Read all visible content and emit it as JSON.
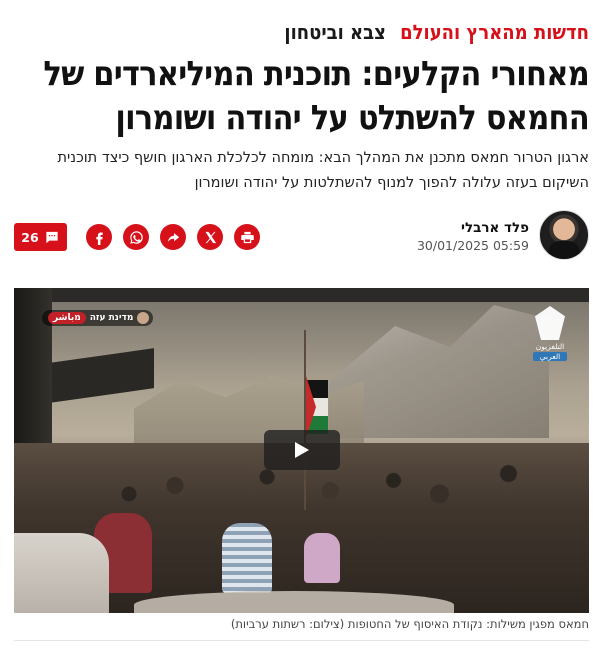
{
  "breadcrumb": {
    "section": "חדשות מהארץ והעולם",
    "subsection": "צבא וביטחון"
  },
  "article": {
    "headline": "מאחורי הקלעים: תוכנית המיליארדים של החמאס להשתלט על יהודה ושומרון",
    "subheadline": "ארגון הטרור חמאס מתכנן את המהלך הבא: מומחה לכלכלת הארגון חושף כיצד תוכנית השיקום בעזה עלולה להפוך למנוף להשתלטות על יהודה ושומרון"
  },
  "author": {
    "name": "פלד ארבלי",
    "date": "30/01/2025 05:59"
  },
  "share": {
    "buttons": [
      "facebook-icon",
      "whatsapp-icon",
      "share-arrow-icon",
      "x-icon",
      "print-icon"
    ],
    "comments_count": "26"
  },
  "media": {
    "live_location": "מדינת עזה",
    "live_label": "מباشر",
    "channel_line1": "التلفزيون",
    "channel_line2": "العربي",
    "caption": "חמאס מפגין משילות: נקודת האיסוף של החטופות (צילום: רשתות ערביות)"
  },
  "colors": {
    "accent": "#d6111a",
    "text": "#1a1a1a"
  }
}
